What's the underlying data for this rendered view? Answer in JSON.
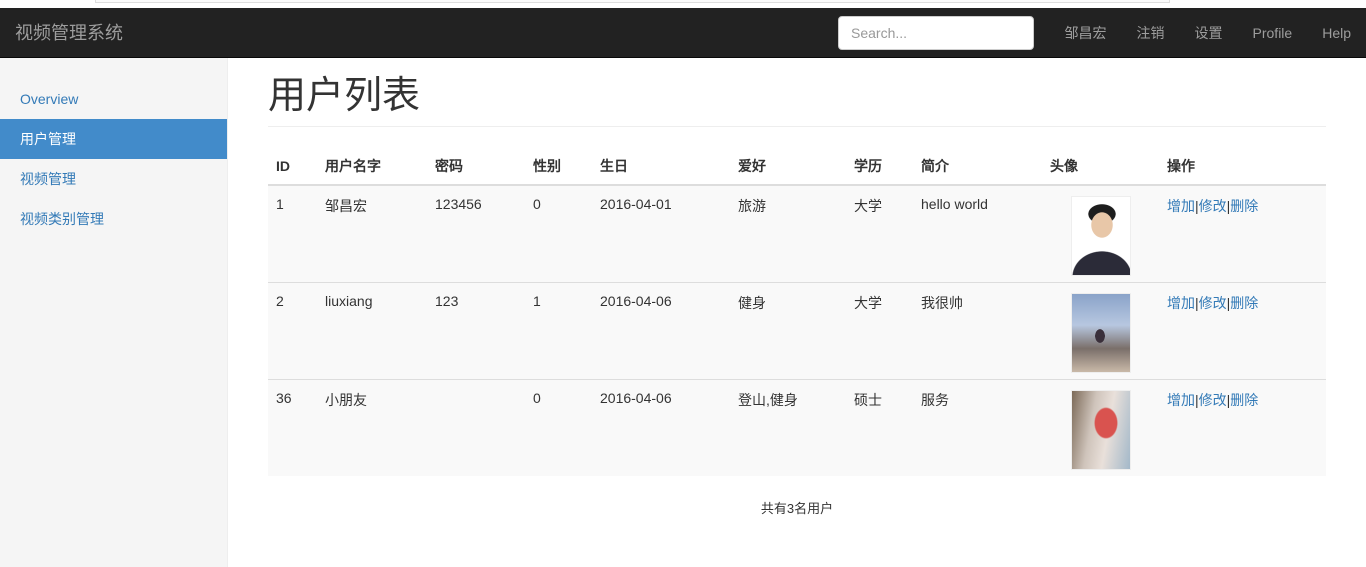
{
  "navbar": {
    "brand": "视频管理系统",
    "search_placeholder": "Search...",
    "links": [
      "邹昌宏",
      "注销",
      "设置",
      "Profile",
      "Help"
    ]
  },
  "sidebar": {
    "items": [
      {
        "label": "Overview",
        "active": false
      },
      {
        "label": "用户管理",
        "active": true
      },
      {
        "label": "视频管理",
        "active": false
      },
      {
        "label": "视频类别管理",
        "active": false
      }
    ]
  },
  "main": {
    "title": "用户列表",
    "table": {
      "columns": [
        "ID",
        "用户名字",
        "密码",
        "性别",
        "生日",
        "爱好",
        "学历",
        "简介",
        "头像",
        "操作"
      ],
      "rows": [
        {
          "id": "1",
          "name": "邹昌宏",
          "password": "123456",
          "gender": "0",
          "birthday": "2016-04-01",
          "hobby": "旅游",
          "education": "大学",
          "intro": "hello world"
        },
        {
          "id": "2",
          "name": "liuxiang",
          "password": "123",
          "gender": "1",
          "birthday": "2016-04-06",
          "hobby": "健身",
          "education": "大学",
          "intro": "我很帅"
        },
        {
          "id": "36",
          "name": "小朋友",
          "password": "",
          "gender": "0",
          "birthday": "2016-04-06",
          "hobby": "登山,健身",
          "education": "硕士",
          "intro": "服务"
        }
      ],
      "actions": {
        "add": "增加",
        "edit": "修改",
        "delete": "删除",
        "separator": "|"
      }
    },
    "total": "共有3名用户"
  }
}
